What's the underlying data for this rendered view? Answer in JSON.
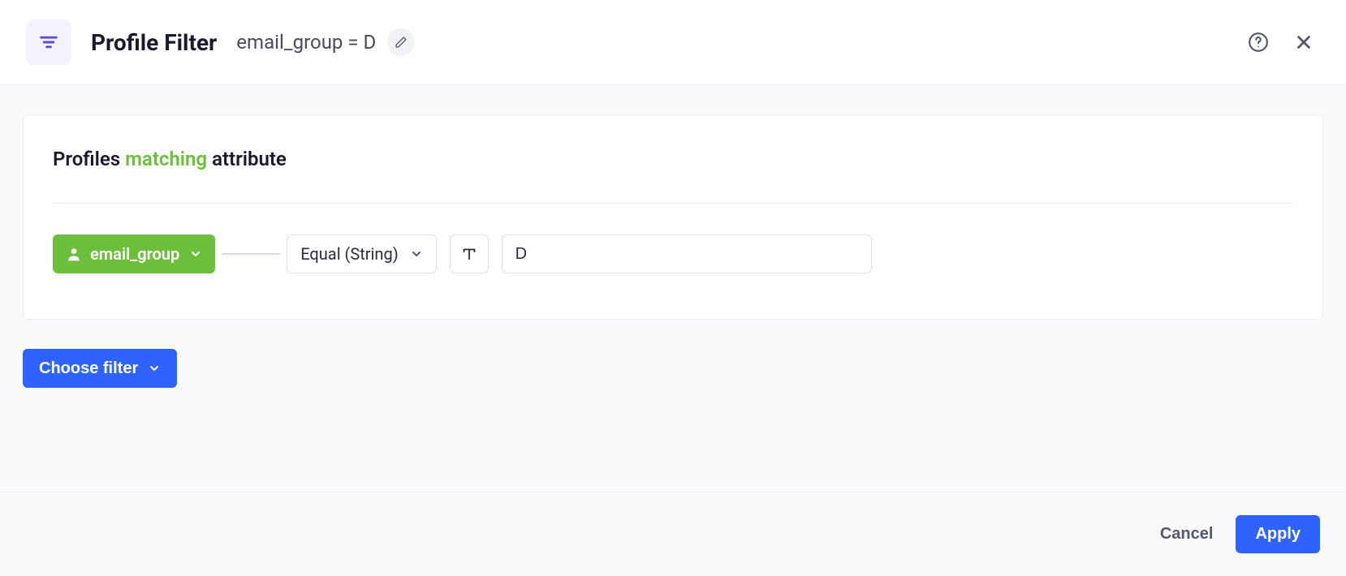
{
  "header": {
    "title": "Profile Filter",
    "subtitle": "email_group = D"
  },
  "card": {
    "heading_prefix": "Profiles",
    "heading_match": "matching",
    "heading_suffix": "attribute",
    "attribute_chip": "email_group",
    "operator": "Equal (String)",
    "value": "D"
  },
  "actions": {
    "choose_filter": "Choose filter",
    "cancel": "Cancel",
    "apply": "Apply"
  }
}
